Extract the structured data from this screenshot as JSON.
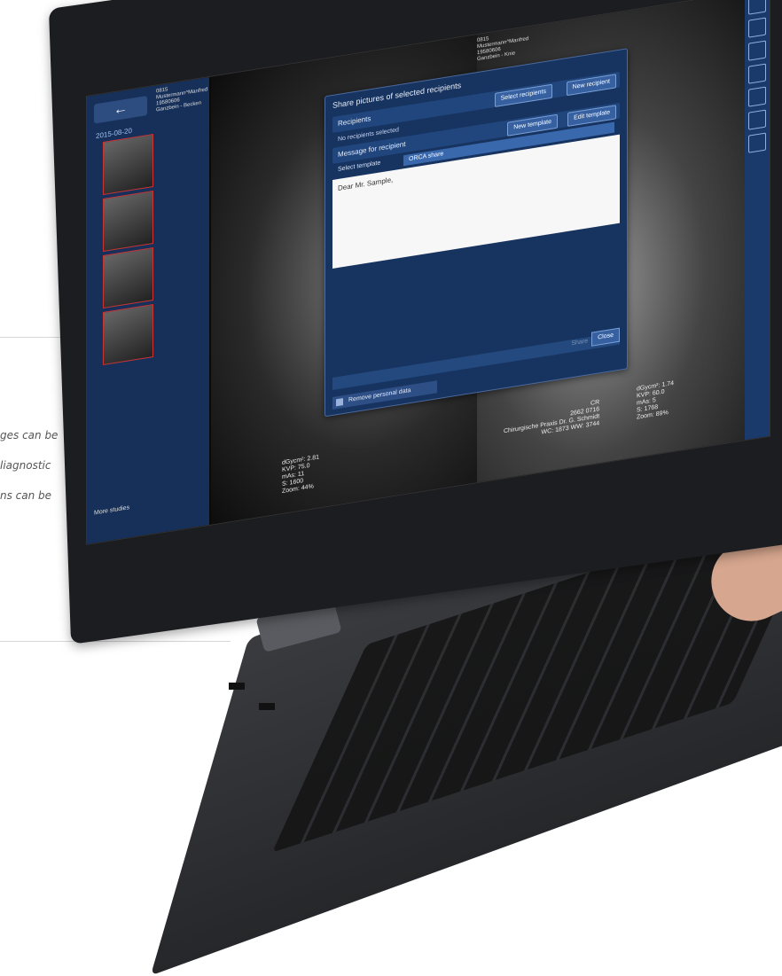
{
  "article": {
    "caption_lines": [
      "ges can be",
      "liagnostic",
      "ns can be"
    ]
  },
  "app": {
    "back_arrow": "←",
    "study_date": "2015-08-20",
    "patient_lines": [
      "0815",
      "Mustermann^Manfred",
      "19580606",
      "Ganzbein - Becken"
    ],
    "more_studies": "More studies",
    "left_stats": [
      "dGycm²: 2.81",
      "KVP: 75.0",
      "mAs: 11",
      "S: 1600",
      "Zoom: 44%"
    ],
    "right_stats": [
      "dGycm²: 1.74",
      "KVP: 60.0",
      "mAs: 5",
      "S: 1768",
      "Zoom: 89%"
    ],
    "practice_lines": [
      "CR",
      "2662 0716",
      "Chirurgische Praxis Dr. G. Schmidt",
      "WC: 1873 WW: 3744"
    ],
    "right_patient_lines": [
      "0815",
      "Mustermann^Manfred",
      "19580606",
      "Ganzbein - Knie"
    ]
  },
  "dialog": {
    "title": "Share pictures of selected recipients",
    "recipients_label": "Recipients",
    "select_recipients": "Select recipients",
    "new_recipient": "New recipient",
    "no_recipients": "No recipients selected",
    "message_label": "Message for recipient",
    "new_template": "New template",
    "edit_template": "Edit template",
    "select_template_label": "Select template",
    "template_value": "ORCA share",
    "message_text": "Dear Mr. Sample,",
    "share": "Share",
    "close": "Close",
    "remove_personal": "Remove personal data"
  },
  "colors": {
    "dialog_bg": "#17335f",
    "accent": "#36609f",
    "panel": "#16305a"
  }
}
